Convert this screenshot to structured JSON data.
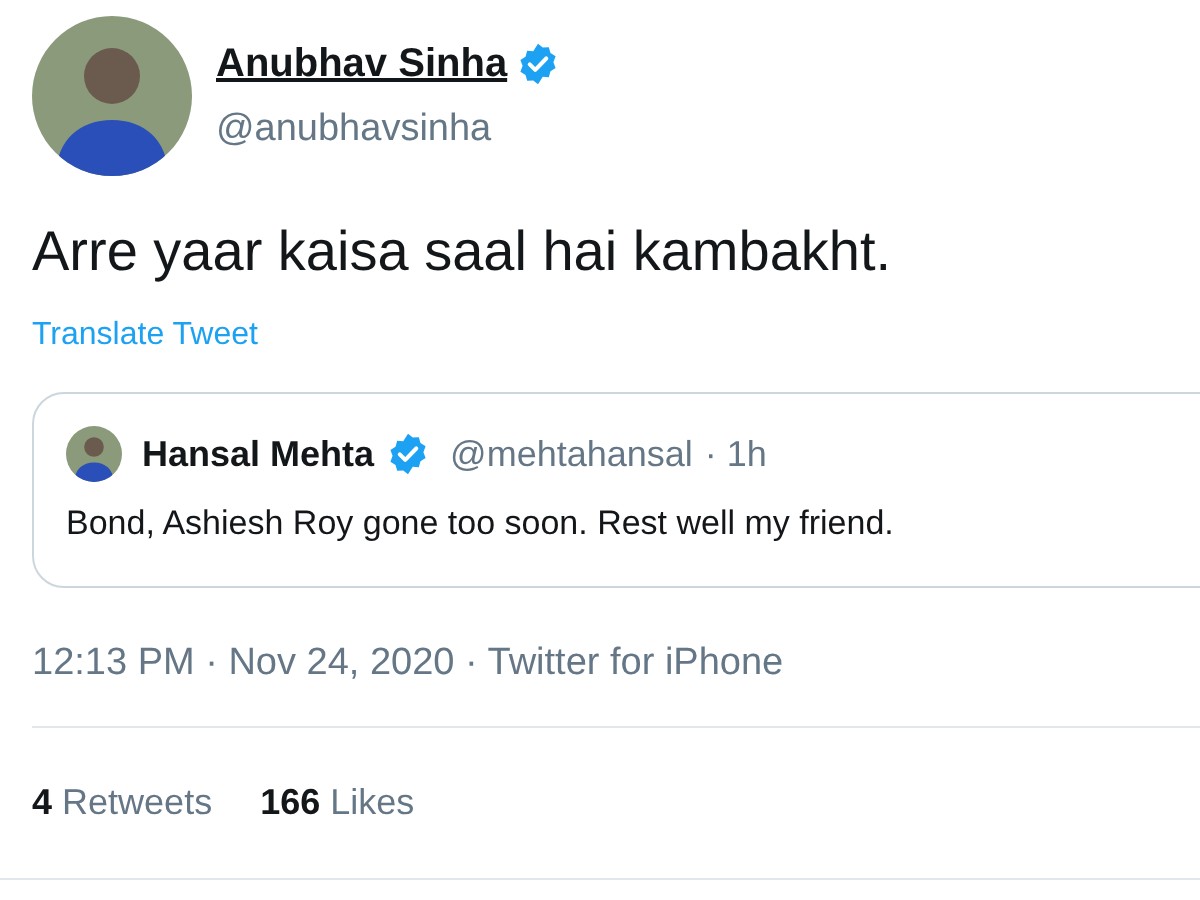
{
  "author": {
    "name": "Anubhav Sinha",
    "verified": true,
    "handle": "@anubhavsinha"
  },
  "text": "Arre yaar kaisa saal hai kambakht.",
  "translate": "Translate Tweet",
  "quote": {
    "name": "Hansal Mehta",
    "verified": true,
    "handle": "@mehtahansal",
    "time": "· 1h",
    "text": "Bond, Ashiesh Roy gone too soon. Rest well my friend."
  },
  "meta": "12:13 PM · Nov 24, 2020 · Twitter for iPhone",
  "stats": [
    {
      "count": "4",
      "label": "Retweets"
    },
    {
      "count": "166",
      "label": "Likes"
    }
  ]
}
